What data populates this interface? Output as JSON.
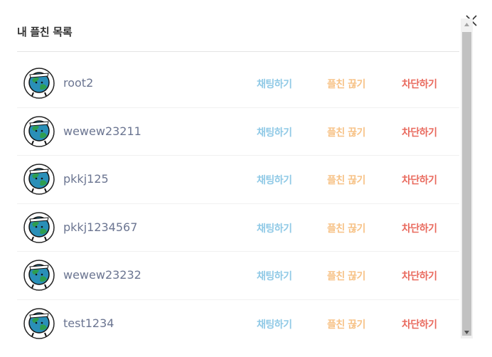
{
  "modal": {
    "title": "내 플친 목록",
    "close_icon": "close-icon"
  },
  "actions": {
    "chat_label": "채팅하기",
    "unfriend_label": "플친 끊기",
    "block_label": "차단하기"
  },
  "friends": [
    {
      "name": "root2"
    },
    {
      "name": "wewew23211"
    },
    {
      "name": "pkkj125"
    },
    {
      "name": "pkkj1234567"
    },
    {
      "name": "wewew23232"
    },
    {
      "name": "test1234"
    }
  ],
  "colors": {
    "chat": "#8fc9e6",
    "unfriend": "#f7c388",
    "block": "#e96a5e",
    "name": "#6b7591"
  }
}
